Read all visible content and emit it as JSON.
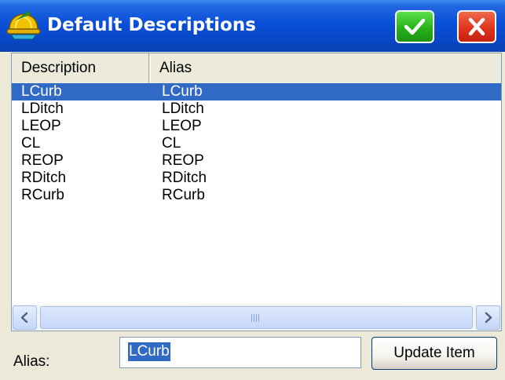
{
  "window": {
    "title": "Default Descriptions",
    "icon": "hard-hat-icon"
  },
  "titlebar_buttons": {
    "ok_icon": "checkmark-icon",
    "close_icon": "close-icon",
    "ok_color": "#27b21a",
    "close_color": "#e0341e"
  },
  "list": {
    "columns": [
      "Description",
      "Alias"
    ],
    "rows": [
      {
        "description": "LCurb",
        "alias": "LCurb",
        "selected": true
      },
      {
        "description": "LDitch",
        "alias": "LDitch",
        "selected": false
      },
      {
        "description": "LEOP",
        "alias": "LEOP",
        "selected": false
      },
      {
        "description": "CL",
        "alias": "CL",
        "selected": false
      },
      {
        "description": "REOP",
        "alias": "REOP",
        "selected": false
      },
      {
        "description": "RDitch",
        "alias": "RDitch",
        "selected": false
      },
      {
        "description": "RCurb",
        "alias": "RCurb",
        "selected": false
      }
    ],
    "selection_color": "#316ac5"
  },
  "form": {
    "alias_label": "Alias:",
    "alias_value": "LCurb",
    "update_button": "Update Item"
  }
}
